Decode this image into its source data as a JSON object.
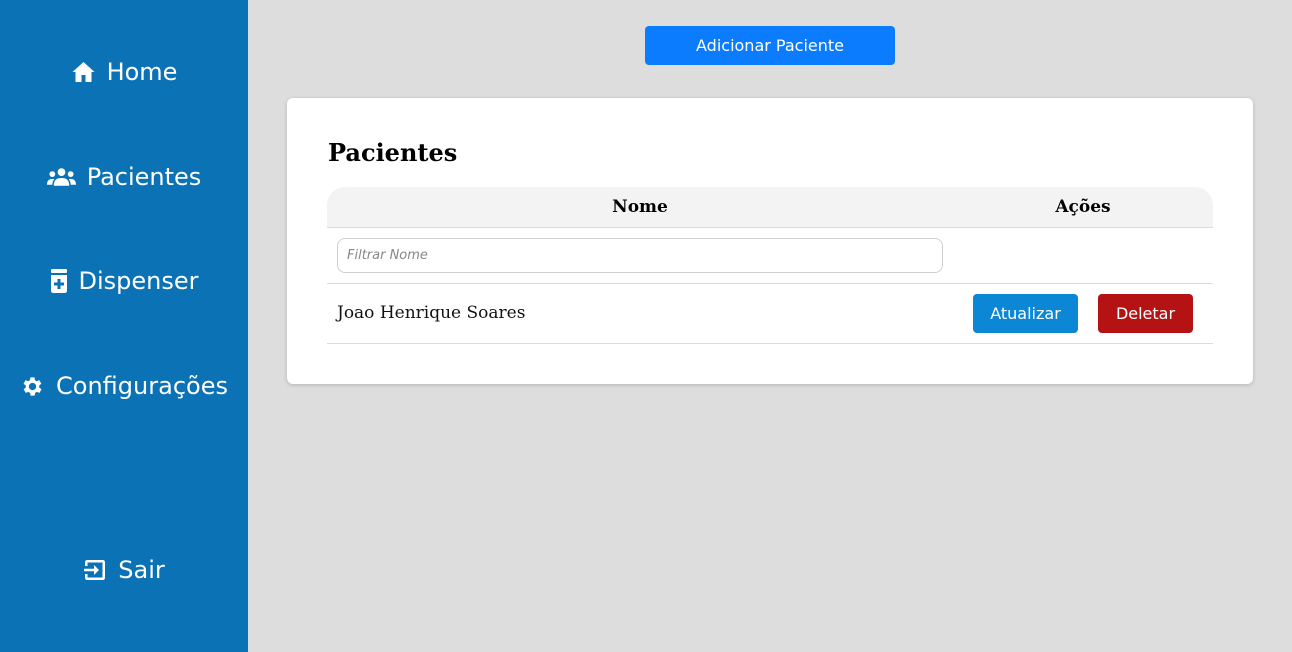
{
  "sidebar": {
    "items": [
      {
        "label": "Home",
        "icon": "home-icon"
      },
      {
        "label": "Pacientes",
        "icon": "users-icon"
      },
      {
        "label": "Dispenser",
        "icon": "medicine-icon"
      },
      {
        "label": "Configurações",
        "icon": "gear-icon"
      }
    ],
    "logout": {
      "label": "Sair",
      "icon": "logout-icon"
    },
    "background": "#0b72b5"
  },
  "toolbar": {
    "add_label": "Adicionar Paciente",
    "add_color": "#0a7cfd"
  },
  "card": {
    "title": "Pacientes",
    "columns": [
      "Nome",
      "Ações"
    ],
    "filter": {
      "placeholder": "Filtrar Nome",
      "value": ""
    },
    "rows": [
      {
        "nome": "Joao Henrique Soares",
        "update_label": "Atualizar",
        "delete_label": "Deletar"
      }
    ]
  },
  "colors": {
    "update": "#0b87d6",
    "delete": "#b51214",
    "page_bg": "#dddddd"
  }
}
